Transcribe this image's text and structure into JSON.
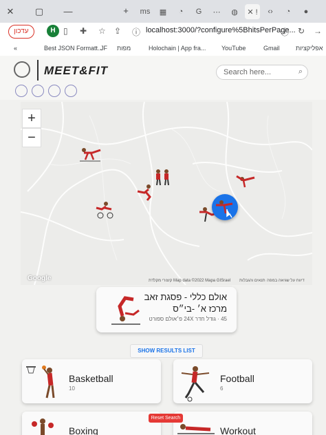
{
  "browser": {
    "profile_label": "עדכון",
    "avatar_letter": "H",
    "url": "localhost:3000/?configure%5BhitsPerPage...",
    "bookmarks": [
      "«",
      "Best JSON Formatt...",
      "JF",
      "מפות",
      "Holochain | App fra...",
      "YouTube",
      "Gmail",
      "אפליקציות"
    ]
  },
  "app": {
    "logo_text": "MEET&FIT",
    "search_placeholder": "Search here..."
  },
  "map": {
    "zoom_in": "+",
    "zoom_out": "−",
    "google_label": "Google",
    "attribution": [
      "קיצורי מקלדת",
      "Map data ©2022 Mapa GISrael",
      "תנאים והגבלות",
      "דיווח על שגיאה במפה"
    ]
  },
  "venue": {
    "name": "אולם כללי - פסגת זאב מרכז א׳ -בי״ס",
    "info": "45 · גודל חדר 24X פ׳אולם ספורט"
  },
  "results": {
    "show_list_label": "SHOW RESULTS LIST",
    "reset_label": "Reset Search",
    "sports": [
      {
        "name": "Basketball",
        "count": "10"
      },
      {
        "name": "Football",
        "count": "6"
      },
      {
        "name": "Boxing",
        "count": ""
      },
      {
        "name": "Workout",
        "count": ""
      }
    ]
  },
  "colors": {
    "accent": "#1a73e8",
    "athlete_red": "#c62828",
    "reset_red": "#e53935"
  }
}
